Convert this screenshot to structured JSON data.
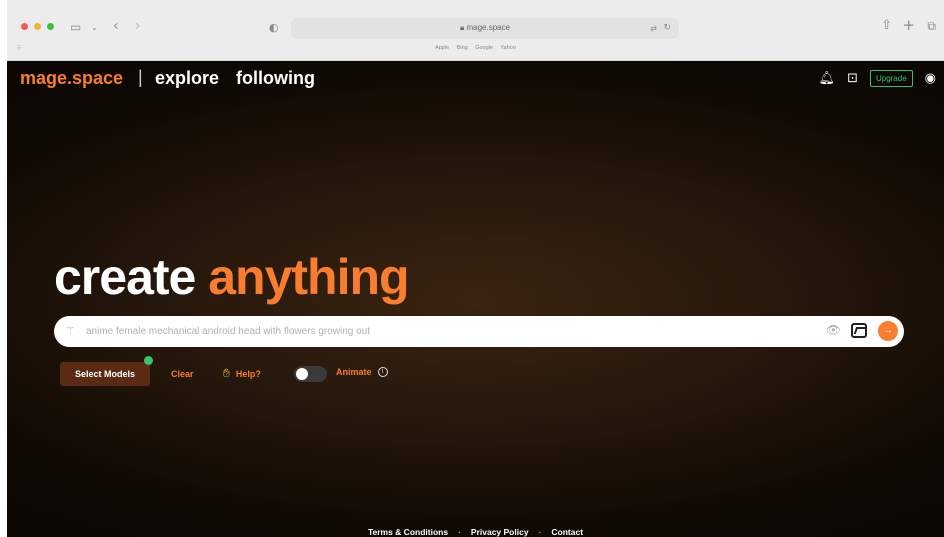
{
  "browser": {
    "url": "mage.space",
    "favorites": [
      "Apple",
      "Bing",
      "Google",
      "Yahoo"
    ],
    "icons": [
      "sidebar-icon",
      "back-icon",
      "forward-icon",
      "shield-icon",
      "lock-icon",
      "translate-icon",
      "reload-icon",
      "share-icon",
      "new-tab-icon",
      "tabs-overview-icon"
    ]
  },
  "nav": {
    "brand": "mage.space",
    "separator": "|",
    "links": [
      "explore",
      "following"
    ],
    "upgrade_label": "Upgrade",
    "icons": [
      "bell-icon",
      "discord-icon",
      "account-icon"
    ]
  },
  "hero": {
    "word1": "create",
    "word2": "anything"
  },
  "prompt": {
    "placeholder": "anime female mechanical android head with flowers growing out",
    "value": ""
  },
  "controls": {
    "select_models": "Select Models",
    "clear": "Clear",
    "help": "Help?",
    "animate": "Animate",
    "animate_on": false
  },
  "footer": {
    "links": [
      "Terms & Conditions",
      "Privacy Policy",
      "Contact"
    ],
    "separator": "·"
  },
  "colors": {
    "accent": "#f97d2e",
    "upgrade": "#35c26a",
    "status_dot": "#3ec36b"
  }
}
